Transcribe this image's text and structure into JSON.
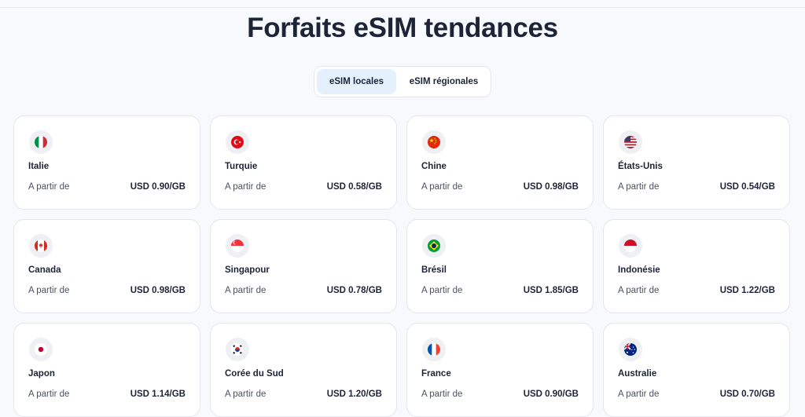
{
  "header": {
    "title": "Forfaits eSIM tendances"
  },
  "tabs": [
    {
      "label": "eSIM locales",
      "active": true
    },
    {
      "label": "eSIM régionales",
      "active": false
    }
  ],
  "cards": [
    {
      "country": "Italie",
      "from": "A partir de",
      "price": "USD 0.90/GB",
      "flag_icon": "italy-flag-icon"
    },
    {
      "country": "Turquie",
      "from": "A partir de",
      "price": "USD 0.58/GB",
      "flag_icon": "turkey-flag-icon"
    },
    {
      "country": "Chine",
      "from": "A partir de",
      "price": "USD 0.98/GB",
      "flag_icon": "china-flag-icon"
    },
    {
      "country": "États-Unis",
      "from": "A partir de",
      "price": "USD 0.54/GB",
      "flag_icon": "usa-flag-icon"
    },
    {
      "country": "Canada",
      "from": "A partir de",
      "price": "USD 0.98/GB",
      "flag_icon": "canada-flag-icon"
    },
    {
      "country": "Singapour",
      "from": "A partir de",
      "price": "USD 0.78/GB",
      "flag_icon": "singapore-flag-icon"
    },
    {
      "country": "Brésil",
      "from": "A partir de",
      "price": "USD 1.85/GB",
      "flag_icon": "brazil-flag-icon"
    },
    {
      "country": "Indonésie",
      "from": "A partir de",
      "price": "USD 1.22/GB",
      "flag_icon": "indonesia-flag-icon"
    },
    {
      "country": "Japon",
      "from": "A partir de",
      "price": "USD 1.14/GB",
      "flag_icon": "japan-flag-icon"
    },
    {
      "country": "Corée du Sud",
      "from": "A partir de",
      "price": "USD 1.20/GB",
      "flag_icon": "south-korea-flag-icon"
    },
    {
      "country": "France",
      "from": "A partir de",
      "price": "USD 0.90/GB",
      "flag_icon": "france-flag-icon"
    },
    {
      "country": "Australie",
      "from": "A partir de",
      "price": "USD 0.70/GB",
      "flag_icon": "australia-flag-icon"
    }
  ]
}
